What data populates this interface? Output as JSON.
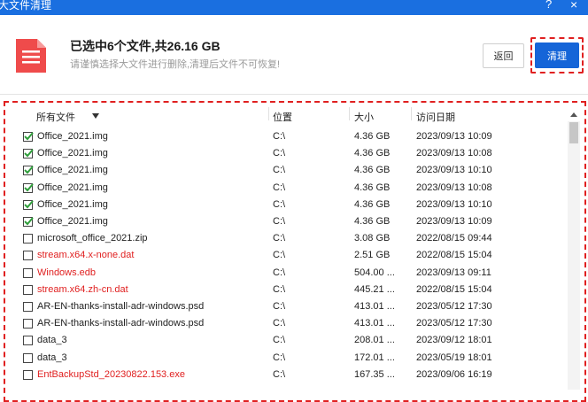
{
  "window": {
    "title": "大文件清理",
    "help": "?",
    "close": "×"
  },
  "header": {
    "title": "已选中6个文件,共26.16 GB",
    "subtitle": "请谨慎选择大文件进行删除,清理后文件不可恢复!",
    "back_label": "返回",
    "clean_label": "清理"
  },
  "columns": {
    "all_files": "所有文件",
    "location": "位置",
    "size": "大小",
    "date": "访问日期"
  },
  "colors": {
    "accent": "#1565d8",
    "danger": "#e02020",
    "check": "#2e9e3a"
  },
  "rows": [
    {
      "name": "Office_2021.img",
      "location": "C:\\",
      "size": "4.36 GB",
      "date": "2023/09/13 10:09",
      "checked": true,
      "red": false
    },
    {
      "name": "Office_2021.img",
      "location": "C:\\",
      "size": "4.36 GB",
      "date": "2023/09/13 10:08",
      "checked": true,
      "red": false
    },
    {
      "name": "Office_2021.img",
      "location": "C:\\",
      "size": "4.36 GB",
      "date": "2023/09/13 10:10",
      "checked": true,
      "red": false
    },
    {
      "name": "Office_2021.img",
      "location": "C:\\",
      "size": "4.36 GB",
      "date": "2023/09/13 10:08",
      "checked": true,
      "red": false
    },
    {
      "name": "Office_2021.img",
      "location": "C:\\",
      "size": "4.36 GB",
      "date": "2023/09/13 10:10",
      "checked": true,
      "red": false
    },
    {
      "name": "Office_2021.img",
      "location": "C:\\",
      "size": "4.36 GB",
      "date": "2023/09/13 10:09",
      "checked": true,
      "red": false
    },
    {
      "name": "microsoft_office_2021.zip",
      "location": "C:\\",
      "size": "3.08 GB",
      "date": "2022/08/15 09:44",
      "checked": false,
      "red": false
    },
    {
      "name": "stream.x64.x-none.dat",
      "location": "C:\\",
      "size": "2.51 GB",
      "date": "2022/08/15 15:04",
      "checked": false,
      "red": true
    },
    {
      "name": "Windows.edb",
      "location": "C:\\",
      "size": "504.00 ...",
      "date": "2023/09/13 09:11",
      "checked": false,
      "red": true
    },
    {
      "name": "stream.x64.zh-cn.dat",
      "location": "C:\\",
      "size": "445.21 ...",
      "date": "2022/08/15 15:04",
      "checked": false,
      "red": true
    },
    {
      "name": "AR-EN-thanks-install-adr-windows.psd",
      "location": "C:\\",
      "size": "413.01 ...",
      "date": "2023/05/12 17:30",
      "checked": false,
      "red": false
    },
    {
      "name": "AR-EN-thanks-install-adr-windows.psd",
      "location": "C:\\",
      "size": "413.01 ...",
      "date": "2023/05/12 17:30",
      "checked": false,
      "red": false
    },
    {
      "name": "data_3",
      "location": "C:\\",
      "size": "208.01 ...",
      "date": "2023/09/12 18:01",
      "checked": false,
      "red": false
    },
    {
      "name": "data_3",
      "location": "C:\\",
      "size": "172.01 ...",
      "date": "2023/05/19 18:01",
      "checked": false,
      "red": false
    },
    {
      "name": "EntBackupStd_20230822.153.exe",
      "location": "C:\\",
      "size": "167.35 ...",
      "date": "2023/09/06 16:19",
      "checked": false,
      "red": true
    }
  ]
}
